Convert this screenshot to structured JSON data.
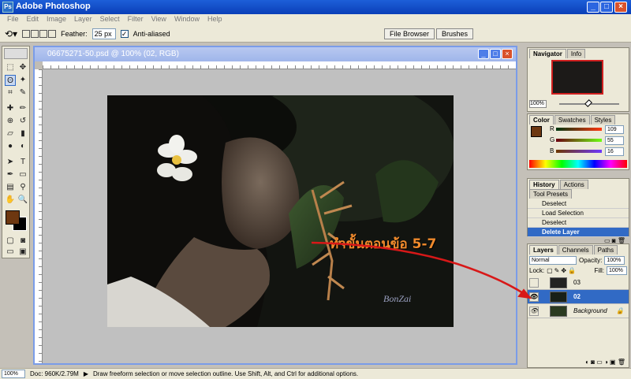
{
  "app": {
    "title": "Adobe Photoshop",
    "icon": "Ps"
  },
  "menu": [
    "File",
    "Edit",
    "Image",
    "Layer",
    "Select",
    "Filter",
    "View",
    "Window",
    "Help"
  ],
  "options": {
    "feather_label": "Feather:",
    "feather_value": "25 px",
    "antialias_label": "Anti-aliased",
    "file_browser": "File Browser",
    "brushes": "Brushes"
  },
  "document": {
    "title": "06675271-50.psd @ 100% (02, RGB)"
  },
  "annotation": {
    "text": "ทำขั้นตอนข้อ 5-7",
    "watermark": "BonZai"
  },
  "navigator": {
    "tabs": [
      "Navigator",
      "Info"
    ],
    "zoom": "100%"
  },
  "color": {
    "tabs": [
      "Color",
      "Swatches",
      "Styles"
    ],
    "r_label": "R",
    "r_value": "109",
    "g_label": "G",
    "g_value": "55",
    "b_label": "B",
    "b_value": "16",
    "foreground": "#6d3710"
  },
  "history": {
    "tabs": [
      "History",
      "Actions",
      "Tool Presets"
    ],
    "items": [
      "Deselect",
      "Load Selection",
      "Deselect",
      "Delete Layer"
    ]
  },
  "layers": {
    "tabs": [
      "Layers",
      "Channels",
      "Paths"
    ],
    "blend_mode": "Normal",
    "opacity_label": "Opacity:",
    "opacity_value": "100%",
    "lock_label": "Lock:",
    "fill_label": "Fill:",
    "fill_value": "100%",
    "items": [
      "03",
      "02",
      "Background"
    ]
  },
  "status": {
    "zoom": "100%",
    "doc": "Doc: 960K/2.79M",
    "hint": "Draw freeform selection or move selection outline.  Use Shift, Alt, and Ctrl for additional options."
  }
}
